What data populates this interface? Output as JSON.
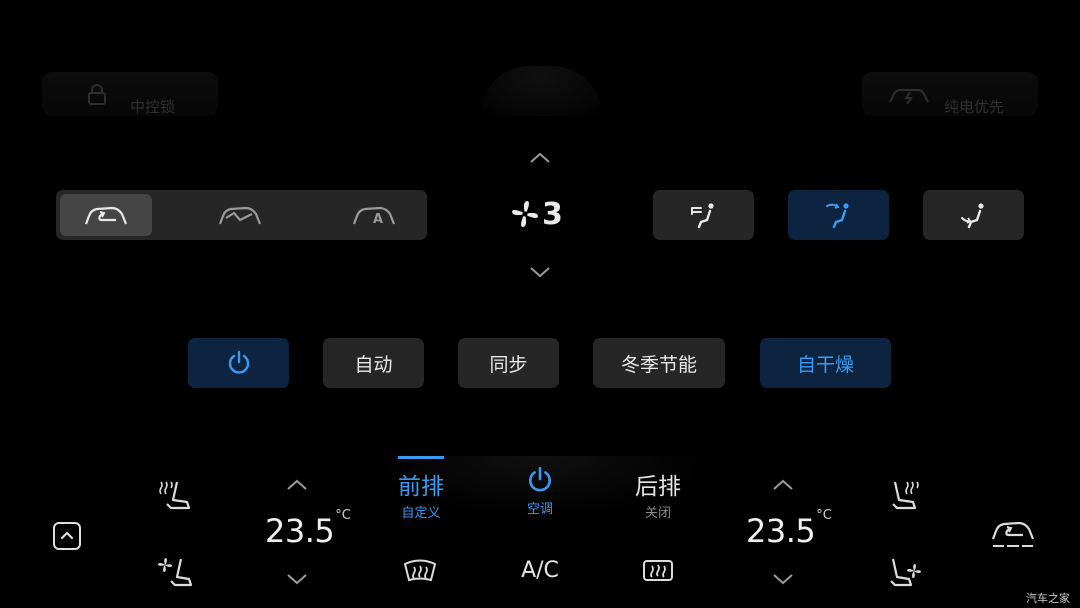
{
  "background_shortcuts": {
    "lock_label": "中控锁",
    "ev_mode_label": "纯电优先"
  },
  "circulation": {
    "modes": [
      {
        "icon": "recirculation-icon",
        "active": true
      },
      {
        "icon": "fresh-air-icon",
        "active": false
      },
      {
        "icon": "auto-circulation-icon",
        "active": false
      }
    ]
  },
  "fan": {
    "level": "3"
  },
  "airflow": {
    "modes": [
      {
        "icon": "face-airflow-icon",
        "active": false
      },
      {
        "icon": "face-feet-airflow-icon",
        "active": true
      },
      {
        "icon": "feet-airflow-icon",
        "active": false
      }
    ]
  },
  "functions": {
    "power": {
      "active": true
    },
    "auto_label": "自动",
    "sync_label": "同步",
    "winter_eco_label": "冬季节能",
    "self_dry_label": "自干燥"
  },
  "bottom_bar": {
    "left_temp": "23.5",
    "right_temp": "23.5",
    "unit": "°C",
    "front_tab": {
      "label": "前排",
      "sub": "自定义"
    },
    "ac_tab": {
      "sub": "空调"
    },
    "rear_tab": {
      "label": "后排",
      "sub": "关闭"
    },
    "ac_button_label": "A/C"
  },
  "watermark": "汽车之家",
  "colors": {
    "accent_blue": "#3a9bf5",
    "active_bg": "#0d2440",
    "panel_bg": "#262626"
  }
}
